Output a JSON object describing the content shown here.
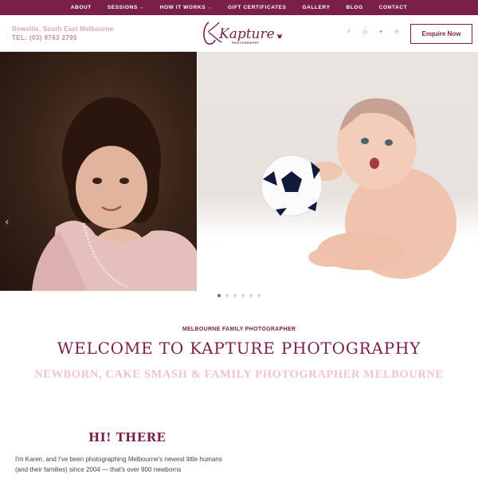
{
  "nav": {
    "items": [
      {
        "label": "ABOUT",
        "has_dropdown": false
      },
      {
        "label": "SESSIONS",
        "has_dropdown": true
      },
      {
        "label": "HOW IT WORKS",
        "has_dropdown": true
      },
      {
        "label": "GIFT CERTIFICATES",
        "has_dropdown": false
      },
      {
        "label": "GALLERY",
        "has_dropdown": false
      },
      {
        "label": "BLOG",
        "has_dropdown": false
      },
      {
        "label": "CONTACT",
        "has_dropdown": false
      }
    ],
    "dropdown_icon": "chevron-down-icon"
  },
  "header": {
    "location": "Rowville, South East Melbourne",
    "phone": "TEL: (03) 9763 2795",
    "logo_text": "Kapture",
    "logo_subtext": "PHOTOGRAPHY",
    "social_icons": [
      "facebook-icon",
      "instagram-icon",
      "twitter-icon",
      "pinterest-icon"
    ],
    "enquire_label": "Enquire Now"
  },
  "hero": {
    "prev_icon": "chevron-left-icon",
    "next_icon": "chevron-right-icon",
    "slide_count": 6,
    "active_slide": 1
  },
  "welcome": {
    "eyebrow": "MELBOURNE FAMILY PHOTOGRAPHER",
    "title": "WELCOME TO KAPTURE PHOTOGRAPHY",
    "subtitle": "NEWBORN, CAKE SMASH & FAMILY PHOTOGRAPHER MELBOURNE"
  },
  "intro": {
    "heading": "HI! THERE",
    "text": "I'm Karen, and I've been photographing Melbourne's newest little humans (and their families) since 2004 — that's over 900 newborns"
  },
  "colors": {
    "brand": "#7a1f47",
    "accent_pink": "#efc4cf",
    "muted_pink": "#c98aa3"
  }
}
